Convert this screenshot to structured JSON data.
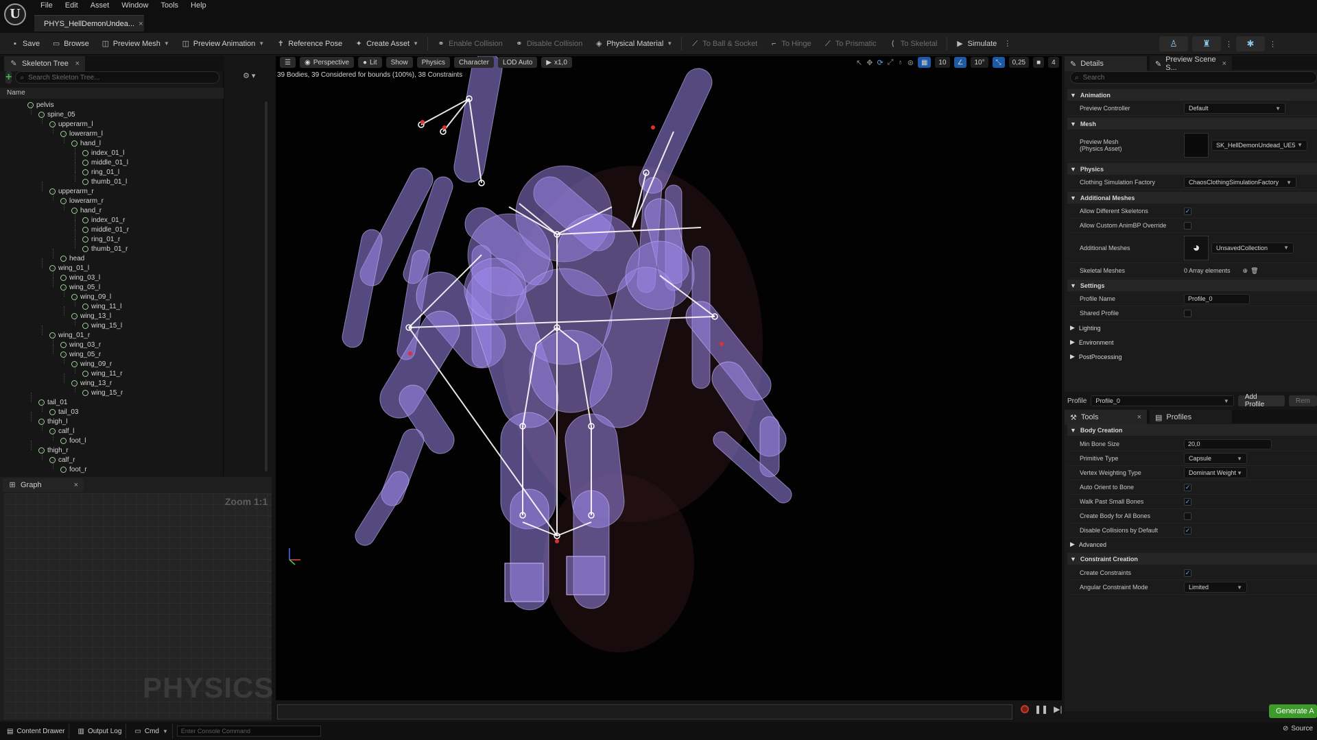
{
  "menu": [
    "File",
    "Edit",
    "Asset",
    "Window",
    "Tools",
    "Help"
  ],
  "doc_tab": {
    "label": "PHYS_HellDemonUndea...",
    "close": "×"
  },
  "toolbar": {
    "save": "Save",
    "browse": "Browse",
    "preview_mesh": "Preview Mesh",
    "preview_animation": "Preview Animation",
    "reference_pose": "Reference Pose",
    "create_asset": "Create Asset",
    "enable_collision": "Enable Collision",
    "disable_collision": "Disable Collision",
    "physical_material": "Physical Material",
    "to_ball_socket": "To Ball & Socket",
    "to_hinge": "To Hinge",
    "to_prismatic": "To Prismatic",
    "to_skeletal": "To Skeletal",
    "simulate": "Simulate"
  },
  "skeleton_tree": {
    "tab": "Skeleton Tree",
    "close": "×",
    "search_placeholder": "Search Skeleton Tree...",
    "column": "Name",
    "bones": [
      {
        "name": "pelvis",
        "depth": 0
      },
      {
        "name": "spine_05",
        "depth": 1
      },
      {
        "name": "upperarm_l",
        "depth": 2
      },
      {
        "name": "lowerarm_l",
        "depth": 3
      },
      {
        "name": "hand_l",
        "depth": 4
      },
      {
        "name": "index_01_l",
        "depth": 5
      },
      {
        "name": "middle_01_l",
        "depth": 5
      },
      {
        "name": "ring_01_l",
        "depth": 5
      },
      {
        "name": "thumb_01_l",
        "depth": 5
      },
      {
        "name": "upperarm_r",
        "depth": 2
      },
      {
        "name": "lowerarm_r",
        "depth": 3
      },
      {
        "name": "hand_r",
        "depth": 4
      },
      {
        "name": "index_01_r",
        "depth": 5
      },
      {
        "name": "middle_01_r",
        "depth": 5
      },
      {
        "name": "ring_01_r",
        "depth": 5
      },
      {
        "name": "thumb_01_r",
        "depth": 5
      },
      {
        "name": "head",
        "depth": 3
      },
      {
        "name": "wing_01_l",
        "depth": 2
      },
      {
        "name": "wing_03_l",
        "depth": 3
      },
      {
        "name": "wing_05_l",
        "depth": 3
      },
      {
        "name": "wing_09_l",
        "depth": 4
      },
      {
        "name": "wing_11_l",
        "depth": 5
      },
      {
        "name": "wing_13_l",
        "depth": 4
      },
      {
        "name": "wing_15_l",
        "depth": 5
      },
      {
        "name": "wing_01_r",
        "depth": 2
      },
      {
        "name": "wing_03_r",
        "depth": 3
      },
      {
        "name": "wing_05_r",
        "depth": 3
      },
      {
        "name": "wing_09_r",
        "depth": 4
      },
      {
        "name": "wing_11_r",
        "depth": 5
      },
      {
        "name": "wing_13_r",
        "depth": 4
      },
      {
        "name": "wing_15_r",
        "depth": 5
      },
      {
        "name": "tail_01",
        "depth": 1
      },
      {
        "name": "tail_03",
        "depth": 2
      },
      {
        "name": "thigh_l",
        "depth": 1
      },
      {
        "name": "calf_l",
        "depth": 2
      },
      {
        "name": "foot_l",
        "depth": 3
      },
      {
        "name": "thigh_r",
        "depth": 1
      },
      {
        "name": "calf_r",
        "depth": 2
      },
      {
        "name": "foot_r",
        "depth": 3
      }
    ]
  },
  "graph": {
    "tab": "Graph",
    "close": "×",
    "zoom": "Zoom 1:1",
    "watermark": "PHYSICS"
  },
  "viewport": {
    "perspective": "Perspective",
    "lit": "Lit",
    "show": "Show",
    "physics": "Physics",
    "character": "Character",
    "lod": "LOD Auto",
    "speed": "x1,0",
    "grid": "10",
    "angle": "10°",
    "scale": "0,25",
    "camera": "4",
    "stats": "39 Bodies, 39 Considered for bounds (100%), 38 Constraints"
  },
  "details": {
    "tab": "Details",
    "tab2": "Preview Scene S...",
    "close": "×",
    "search_placeholder": "Search",
    "animation_cat": "Animation",
    "preview_controller_label": "Preview Controller",
    "preview_controller_value": "Default",
    "mesh_cat": "Mesh",
    "preview_mesh_label": "Preview Mesh",
    "preview_mesh_sub": "(Physics Asset)",
    "preview_mesh_value": "SK_HellDemonUndead_UE5",
    "physics_cat": "Physics",
    "clothing_label": "Clothing Simulation Factory",
    "clothing_value": "ChaosClothingSimulationFactory",
    "additional_cat": "Additional Meshes",
    "allow_diff_label": "Allow Different Skeletons",
    "allow_custom_label": "Allow Custom AnimBP Override",
    "additional_label": "Additional Meshes",
    "additional_value": "UnsavedCollection",
    "skeletal_label": "Skeletal Meshes",
    "skeletal_value": "0 Array elements",
    "settings_cat": "Settings",
    "profile_name_label": "Profile Name",
    "profile_name_value": "Profile_0",
    "shared_profile_label": "Shared Profile",
    "lighting": "Lighting",
    "environment": "Environment",
    "post_processing": "PostProcessing"
  },
  "profile": {
    "label": "Profile",
    "value": "Profile_0",
    "add": "Add Profile",
    "remove": "Rem"
  },
  "tools": {
    "tab": "Tools",
    "close": "×",
    "tab2": "Profiles",
    "body_cat": "Body Creation",
    "min_bone_label": "Min Bone Size",
    "min_bone_value": "20,0",
    "primitive_label": "Primitive Type",
    "primitive_value": "Capsule",
    "vertex_label": "Vertex Weighting Type",
    "vertex_value": "Dominant Weight",
    "auto_orient_label": "Auto Orient to Bone",
    "walk_past_label": "Walk Past Small Bones",
    "create_body_label": "Create Body for All Bones",
    "disable_coll_label": "Disable Collisions by Default",
    "advanced": "Advanced",
    "constraint_cat": "Constraint Creation",
    "create_constraints_label": "Create Constraints",
    "angular_label": "Angular Constraint Mode",
    "angular_value": "Limited"
  },
  "generate": "Generate A",
  "status": {
    "content_drawer": "Content Drawer",
    "output_log": "Output Log",
    "cmd": "Cmd",
    "console_placeholder": "Enter Console Command",
    "source": "Source"
  },
  "colors": {
    "accent_blue": "#1c5aa6",
    "generate_green": "#3f9a2c",
    "body_purple": "#9b86e8",
    "bone_icon": "#9ed29b"
  }
}
